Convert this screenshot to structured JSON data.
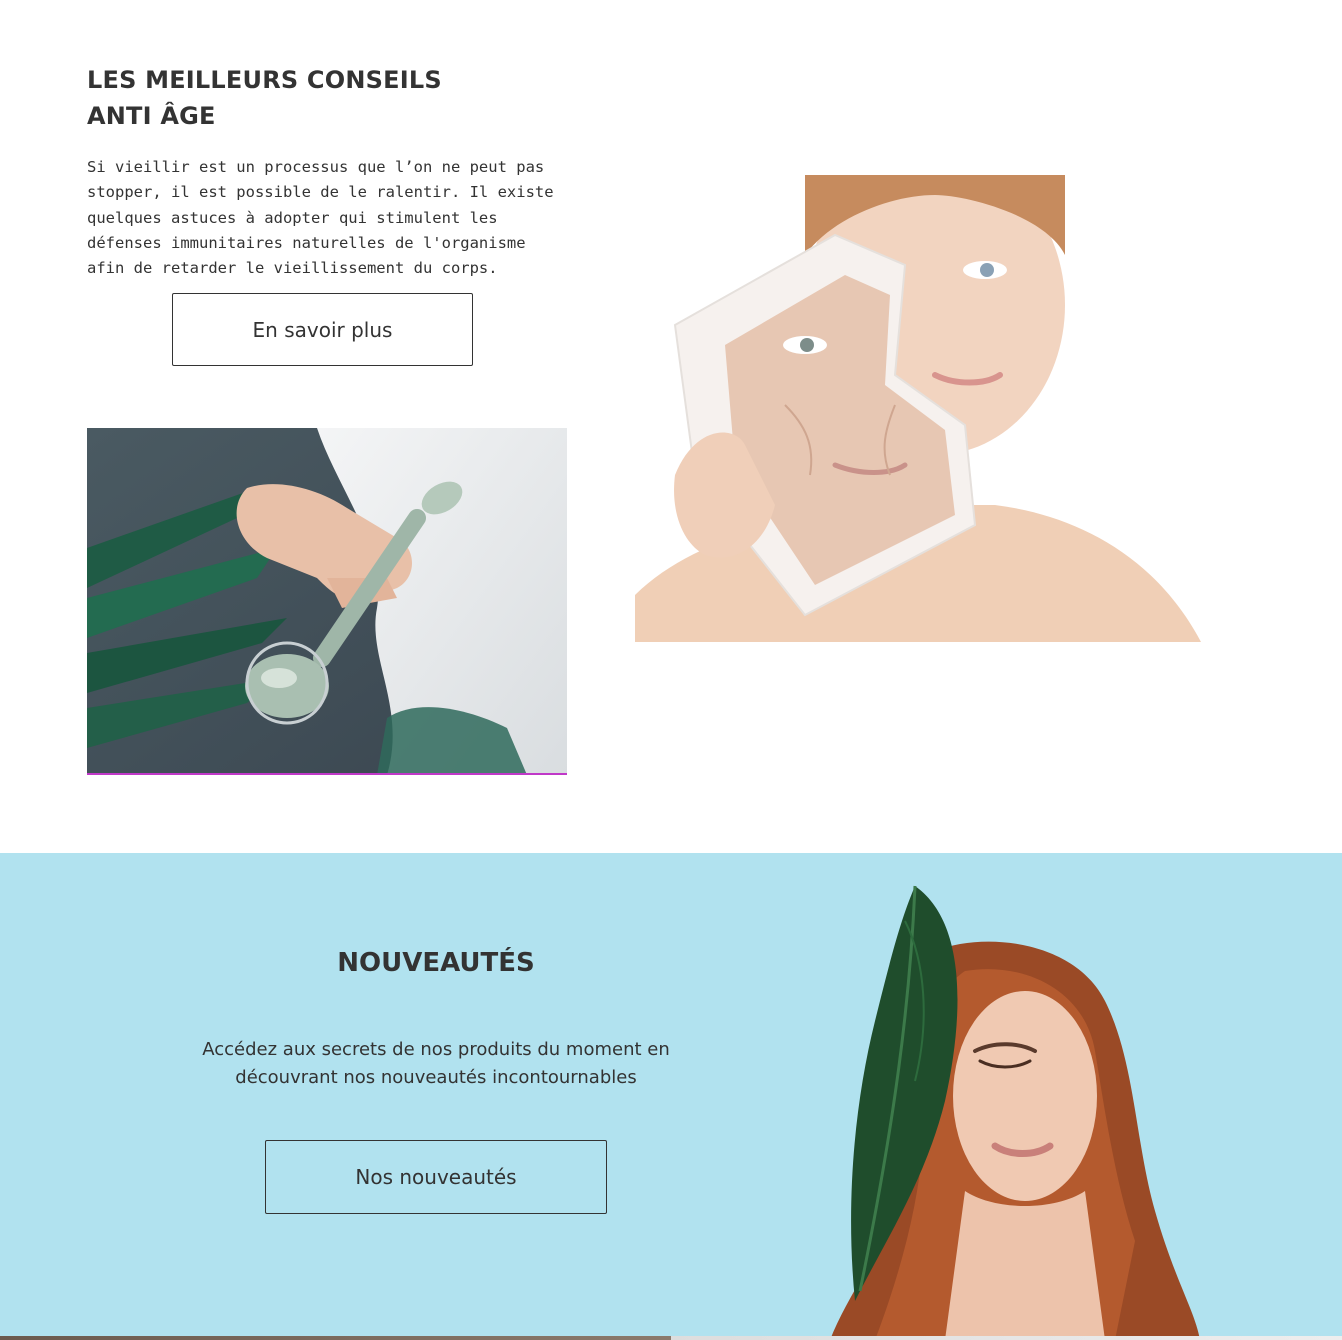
{
  "anti_age": {
    "title_line1": "LES MEILLEURS CONSEILS",
    "title_line2": "ANTI ÂGE",
    "text": "Si vieillir est un processus que l’on ne peut pas stopper, il est possible de le ralentir. Il existe quelques astuces à adopter qui stimulent les défenses immunitaires naturelles de l'organisme afin de retarder le vieillissement du corps.",
    "button_label": "En savoir plus",
    "image_roller": "jade-roller-photo",
    "image_face": "aging-face-photo"
  },
  "nouveautes": {
    "title": "NOUVEAUTÉS",
    "text": "Accédez aux secrets de nos produits du moment en découvrant nos nouveautés incontournables",
    "button_label": "Nos nouveautés",
    "image": "woman-with-leaf-photo",
    "background": "#b1e2ef"
  },
  "colors": {
    "text": "#333333",
    "accent_border": "#c038c8"
  }
}
